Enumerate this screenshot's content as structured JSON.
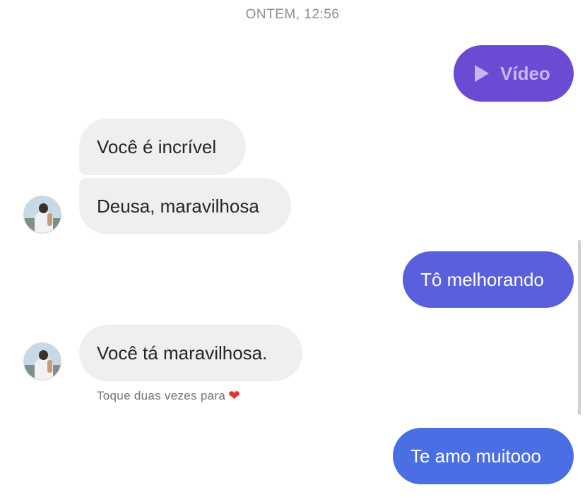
{
  "timestamp": "ONTEM, 12:56",
  "messages": [
    {
      "direction": "out",
      "type": "video",
      "text": "Vídeo",
      "icon": "play-icon",
      "color": "#6c4bd4"
    },
    {
      "direction": "in",
      "text": "Você é incrível"
    },
    {
      "direction": "in",
      "text": "Deusa, maravilhosa"
    },
    {
      "direction": "out",
      "text": "Tô melhorando",
      "color": "#5a5fde"
    },
    {
      "direction": "in",
      "text": "Você tá maravilhosa."
    },
    {
      "direction": "out",
      "text": "Te amo muitooo",
      "color": "#4a6ee3"
    }
  ],
  "hint": {
    "text": "Toque duas vezes para",
    "icon": "heart-icon",
    "glyph": "❤"
  },
  "colors": {
    "incoming_bubble": "#efefef",
    "incoming_text": "#262626",
    "timestamp_text": "#8e8e8e"
  }
}
